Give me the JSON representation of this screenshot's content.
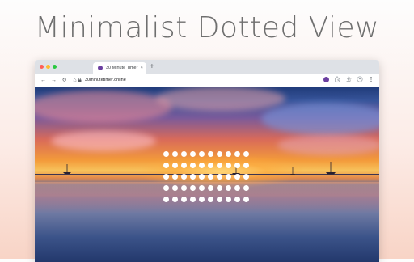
{
  "headline": "Minimalist Dotted View",
  "browser": {
    "traffic_colors": [
      "#ff5f57",
      "#febc2e",
      "#28c840"
    ],
    "tab": {
      "title": "30 Minute Timer",
      "close": "×",
      "favicon": "timer-favicon"
    },
    "new_tab": "+",
    "toolbar": {
      "back": "←",
      "forward": "→",
      "reload": "↻",
      "home": "⌂"
    },
    "url": "30minutetimer.online",
    "star": "☆",
    "right_icons": [
      "extension-timer-icon",
      "puzzle-icon",
      "download-icon",
      "profile-icon",
      "menu-icon"
    ]
  },
  "timer_display": {
    "rows": 5,
    "cols": 10,
    "dot_count": 50,
    "dot_color": "#ffffff"
  },
  "scene": "sunset-over-water"
}
